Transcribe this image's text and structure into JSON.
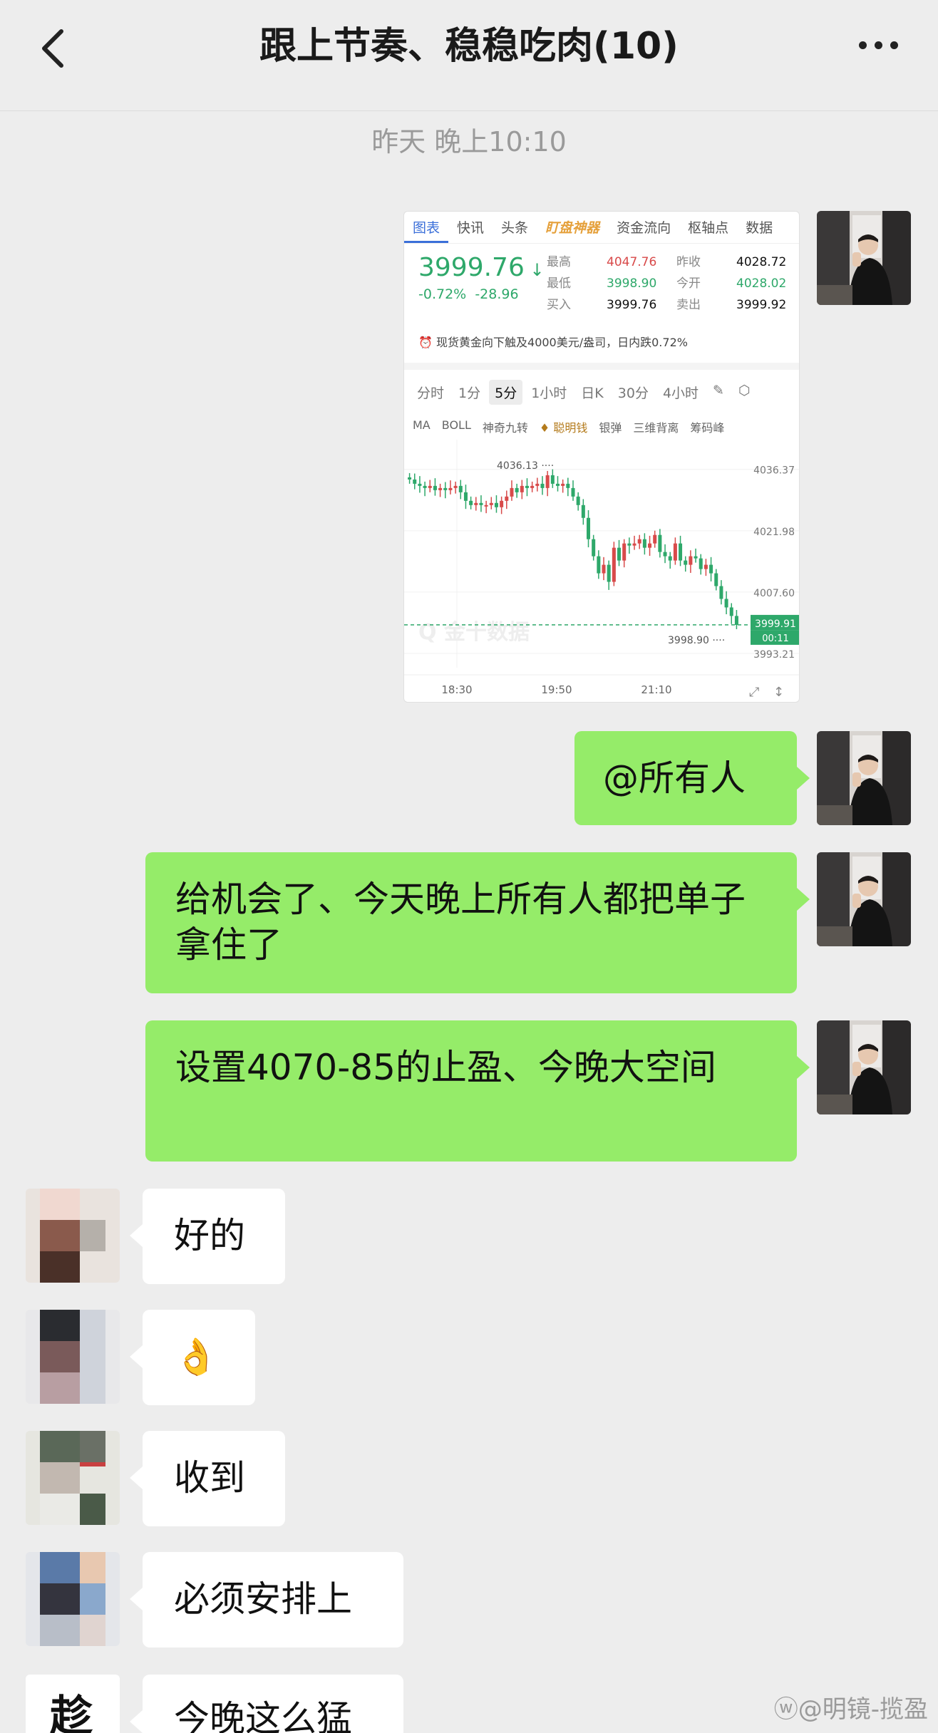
{
  "header": {
    "title": "跟上节奏、稳稳吃肉(10)"
  },
  "timestamp": "昨天 晚上10:10",
  "card": {
    "tabs": [
      "图表",
      "快讯",
      "头条",
      "盯盘神器",
      "资金流向",
      "枢轴点",
      "数据"
    ],
    "price": "3999.76",
    "change_pct": "-0.72%",
    "change_abs": "-28.96",
    "quote_rows": [
      {
        "l1": "最高",
        "v1": "4047.76",
        "l2": "昨收",
        "v2": "4028.72"
      },
      {
        "l1": "最低",
        "v1": "3998.90",
        "l2": "今开",
        "v2": "4028.02"
      },
      {
        "l1": "买入",
        "v1": "3999.76",
        "l2": "卖出",
        "v2": "3999.92"
      }
    ],
    "notice": "现货黄金向下触及4000美元/盎司，日内跌0.72%",
    "k_tabs": [
      "分时",
      "1分",
      "5分",
      "1小时",
      "日K",
      "30分",
      "4小时"
    ],
    "indicators": [
      "MA",
      "BOLL",
      "神奇九转",
      "聪明钱",
      "银弹",
      "三维背离",
      "筹码峰"
    ],
    "watermark": "金十数据"
  },
  "chart_data": {
    "type": "candlestick",
    "x_ticks": [
      "18:30",
      "19:50",
      "21:10"
    ],
    "y_ticks": [
      4036.37,
      4021.98,
      4007.6,
      3993.21
    ],
    "annotations": {
      "high": "4036.13",
      "low": "3998.90",
      "last": "3999.91",
      "countdown": "00:11"
    },
    "ylim": [
      3993.21,
      4040
    ],
    "closes": [
      4034,
      4033,
      4032.5,
      4032,
      4032.5,
      4031.5,
      4032,
      4031.5,
      4032,
      4032.5,
      4031,
      4029,
      4028,
      4028.5,
      4028,
      4028,
      4028.5,
      4027.5,
      4029,
      4030,
      4032,
      4031,
      4032.5,
      4032,
      4032.5,
      4033,
      4032,
      4035,
      4033,
      4032.5,
      4033,
      4032,
      4030,
      4028,
      4025,
      4020,
      4016,
      4012,
      4014,
      4010,
      4018,
      4015,
      4019,
      4018.5,
      4019,
      4020,
      4018,
      4019,
      4021,
      4017,
      4016,
      4015,
      4019,
      4015,
      4014,
      4016,
      4015.5,
      4013,
      4014,
      4012,
      4009,
      4006,
      4004,
      4002,
      3999.9
    ]
  },
  "messages": [
    {
      "text": "@所有人"
    },
    {
      "text": "给机会了、今天晚上所有人都把单子拿住了"
    },
    {
      "text": "设置4070-85的止盈、今晚大空间"
    },
    {
      "text": "好的"
    },
    {
      "text": "👌"
    },
    {
      "text": "收到"
    },
    {
      "text": "必须安排上"
    },
    {
      "text": "今晚这么猛"
    }
  ],
  "last_avatar_char": "趁",
  "site_watermark": "@明镜-揽盈"
}
